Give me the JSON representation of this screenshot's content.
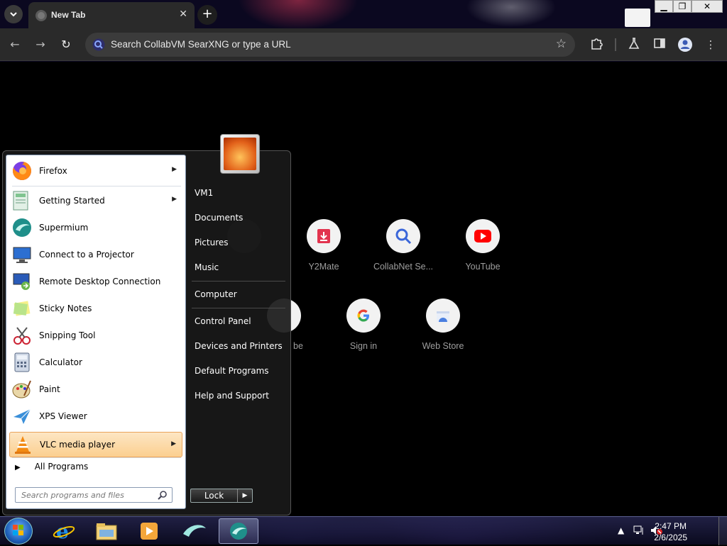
{
  "browser": {
    "tab_title": "New Tab",
    "tab_close": "✕",
    "new_tab": "+",
    "omnibox_placeholder": "Search CollabVM SearXNG or type a URL",
    "shortcuts": [
      {
        "label": "",
        "icon": "blank-circle-icon"
      },
      {
        "label": "Y2Mate",
        "icon": "download-icon"
      },
      {
        "label": "CollabNet Se...",
        "icon": "magnifier-icon"
      },
      {
        "label": "YouTube",
        "icon": "youtube-icon"
      },
      {
        "label": "be",
        "icon": "blank-circle-icon"
      },
      {
        "label": "Sign in",
        "icon": "google-icon"
      },
      {
        "label": "Web Store",
        "icon": "web-store-icon"
      }
    ]
  },
  "start_menu": {
    "programs": [
      {
        "label": "Firefox",
        "icon": "firefox-icon",
        "has_submenu": true
      },
      {
        "label": "Getting Started",
        "icon": "getting-started-icon",
        "has_submenu": true
      },
      {
        "label": "Supermium",
        "icon": "supermium-icon",
        "has_submenu": false
      },
      {
        "label": "Connect to a Projector",
        "icon": "projector-icon",
        "has_submenu": false
      },
      {
        "label": "Remote Desktop Connection",
        "icon": "remote-desktop-icon",
        "has_submenu": false
      },
      {
        "label": "Sticky Notes",
        "icon": "sticky-notes-icon",
        "has_submenu": false
      },
      {
        "label": "Snipping Tool",
        "icon": "snipping-tool-icon",
        "has_submenu": false
      },
      {
        "label": "Calculator",
        "icon": "calculator-icon",
        "has_submenu": false
      },
      {
        "label": "Paint",
        "icon": "paint-icon",
        "has_submenu": false
      },
      {
        "label": "XPS Viewer",
        "icon": "xps-viewer-icon",
        "has_submenu": false
      },
      {
        "label": "VLC media player",
        "icon": "vlc-icon",
        "has_submenu": true,
        "highlighted": true
      }
    ],
    "all_programs": "All Programs",
    "search_placeholder": "Search programs and files",
    "right_links": [
      "VM1",
      "Documents",
      "Pictures",
      "Music",
      "Computer",
      "Control Panel",
      "Devices and Printers",
      "Default Programs",
      "Help and Support"
    ],
    "lock_label": "Lock"
  },
  "taskbar": {
    "clock_time": "2:47 PM",
    "clock_date": "2/6/2025",
    "pinned": [
      "internet-explorer-icon",
      "windows-explorer-icon",
      "media-player-icon",
      "supermium-icon",
      "supermium-icon"
    ]
  }
}
